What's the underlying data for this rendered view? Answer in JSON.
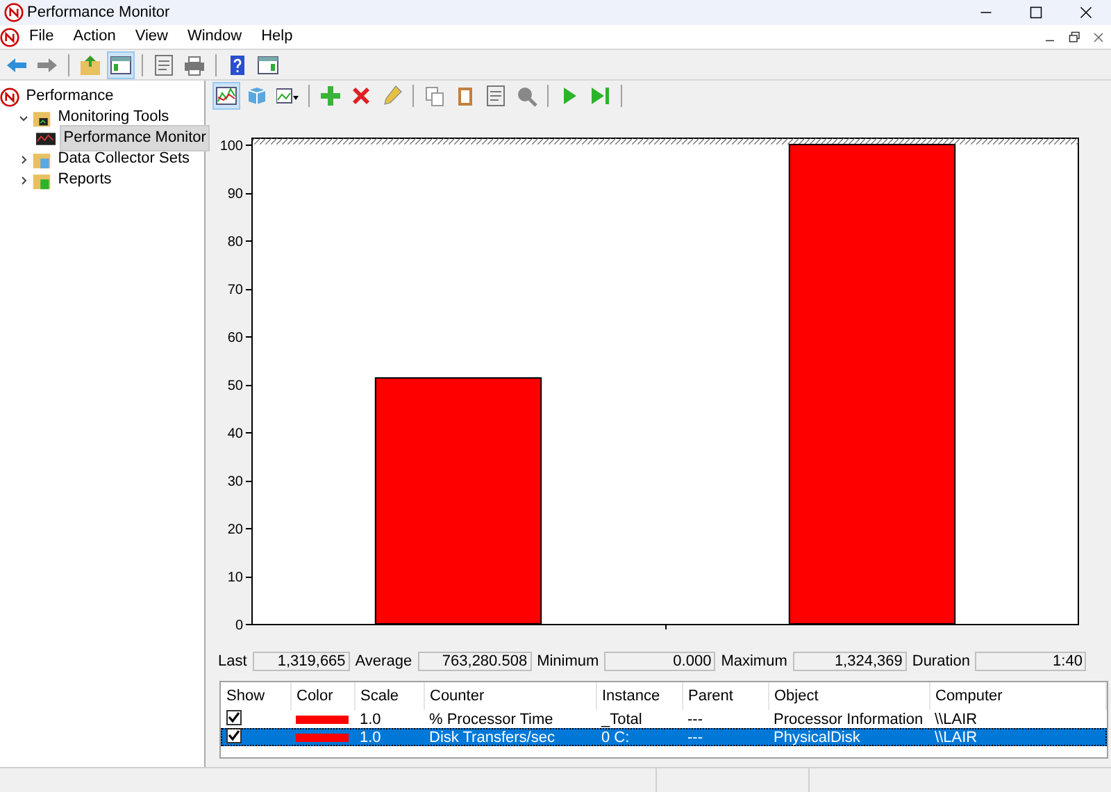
{
  "window": {
    "title": "Performance Monitor"
  },
  "menu": [
    "File",
    "Action",
    "View",
    "Window",
    "Help"
  ],
  "main_toolbar": [
    {
      "kind": "back",
      "pressed": false
    },
    {
      "kind": "forward",
      "pressed": false
    },
    {
      "kind": "sep"
    },
    {
      "kind": "upfolder",
      "pressed": false
    },
    {
      "kind": "tree",
      "pressed": true
    },
    {
      "kind": "sep"
    },
    {
      "kind": "properties",
      "pressed": false
    },
    {
      "kind": "print",
      "pressed": false
    },
    {
      "kind": "sep"
    },
    {
      "kind": "help",
      "pressed": false
    },
    {
      "kind": "pane",
      "pressed": false
    }
  ],
  "tree": [
    {
      "label": "Performance",
      "kind": "perf",
      "selected": false,
      "children": [
        {
          "label": "Monitoring Tools",
          "kind": "tools",
          "selected": false,
          "expanded": true,
          "children": [
            {
              "label": "Performance Monitor",
              "kind": "monitor",
              "selected": true
            }
          ]
        },
        {
          "label": "Data Collector Sets",
          "kind": "collector",
          "selected": false,
          "expanded": false
        },
        {
          "label": "Reports",
          "kind": "reports",
          "selected": false,
          "expanded": false
        }
      ]
    }
  ],
  "chart_toolbar": [
    {
      "kind": "graph",
      "pressed": true
    },
    {
      "kind": "cube",
      "pressed": false
    },
    {
      "kind": "graphtype",
      "pressed": false
    },
    {
      "kind": "sep"
    },
    {
      "kind": "add",
      "pressed": false
    },
    {
      "kind": "delete",
      "pressed": false
    },
    {
      "kind": "highlight",
      "pressed": false
    },
    {
      "kind": "sep"
    },
    {
      "kind": "copy",
      "pressed": false
    },
    {
      "kind": "paste",
      "pressed": false
    },
    {
      "kind": "properties",
      "pressed": false
    },
    {
      "kind": "zoom",
      "pressed": false
    },
    {
      "kind": "sep"
    },
    {
      "kind": "play",
      "pressed": false
    },
    {
      "kind": "step",
      "pressed": false
    },
    {
      "kind": "sep"
    }
  ],
  "chart": {
    "chart_data": {
      "type": "bar",
      "ylim": [
        0,
        100
      ],
      "yticks": [
        0,
        10,
        20,
        30,
        40,
        50,
        60,
        70,
        80,
        90,
        100
      ],
      "series": [
        {
          "color": "#ff0000",
          "values": [
            51.3,
            100
          ]
        }
      ]
    }
  },
  "stats": [
    {
      "label": "Last",
      "value": "1,319,665"
    },
    {
      "label": "Average",
      "value": "763,280.508"
    },
    {
      "label": "Minimum",
      "value": "0.000"
    },
    {
      "label": "Maximum",
      "value": "1,324,369"
    },
    {
      "label": "Duration",
      "value": "1:40"
    }
  ],
  "legend": {
    "columns": [
      "Show",
      "Color",
      "Scale",
      "Counter",
      "Instance",
      "Parent",
      "Object",
      "Computer"
    ],
    "rows": [
      {
        "show": true,
        "color": "#ff0000",
        "scale": "1.0",
        "counter": "% Processor Time",
        "instance": "_Total",
        "parent": "---",
        "object": "Processor Information",
        "computer": "\\\\LAIR",
        "selected": false
      },
      {
        "show": true,
        "color": "#ff0000",
        "scale": "1.0",
        "counter": "Disk Transfers/sec",
        "instance": "0 C:",
        "parent": "---",
        "object": "PhysicalDisk",
        "computer": "\\\\LAIR",
        "selected": true
      }
    ]
  }
}
